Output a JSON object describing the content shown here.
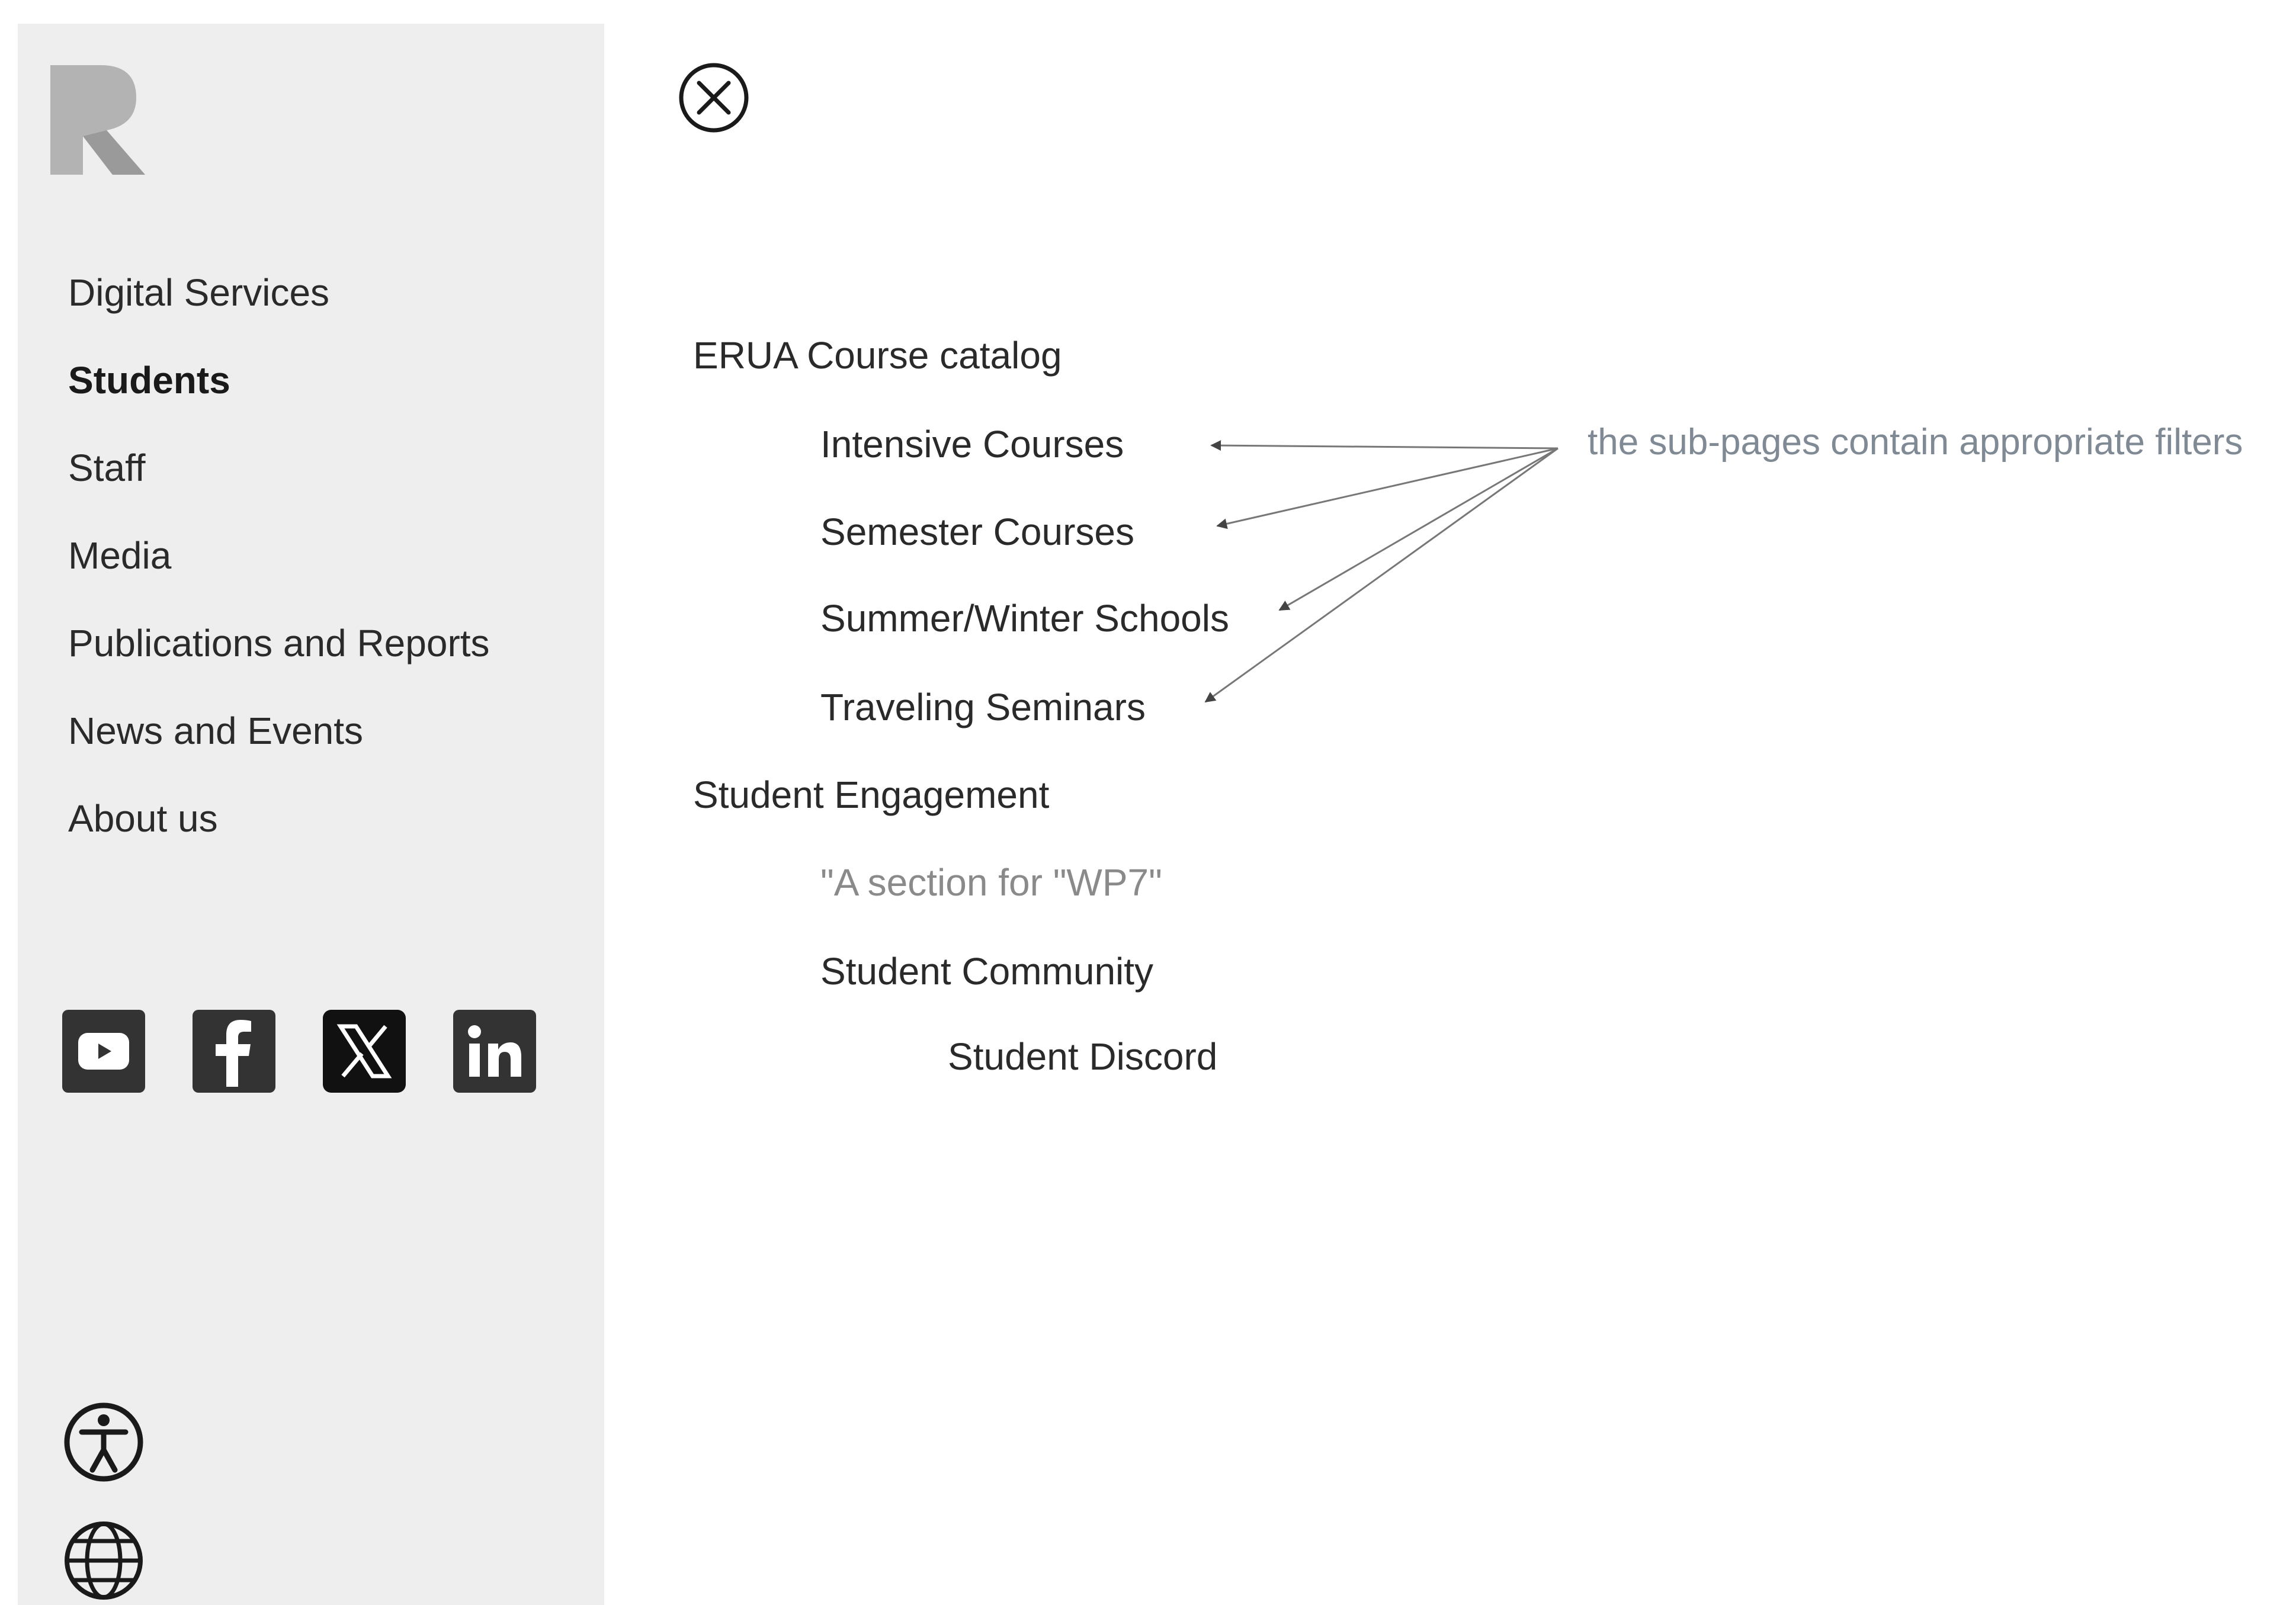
{
  "sidebar": {
    "logo": "erua-logo",
    "nav": [
      {
        "label": "Digital Services",
        "active": false
      },
      {
        "label": "Students",
        "active": true
      },
      {
        "label": "Staff",
        "active": false
      },
      {
        "label": "Media",
        "active": false
      },
      {
        "label": "Publications and Reports",
        "active": false
      },
      {
        "label": "News and Events",
        "active": false
      },
      {
        "label": "About us",
        "active": false
      }
    ],
    "socials": [
      "youtube-icon",
      "facebook-icon",
      "x-icon",
      "linkedin-icon"
    ],
    "utilities": [
      "accessibility-icon",
      "globe-icon"
    ]
  },
  "main": {
    "close_icon": "close-icon",
    "sections": [
      {
        "label": "ERUA Course catalog",
        "items": [
          {
            "label": "Intensive Courses"
          },
          {
            "label": "Semester Courses"
          },
          {
            "label": "Summer/Winter Schools"
          },
          {
            "label": "Traveling Seminars"
          }
        ]
      },
      {
        "label": "Student Engagement",
        "items": [
          {
            "label": "\"A section for \"WP7\"",
            "note": true
          },
          {
            "label": "Student Community",
            "children": [
              {
                "label": "Student Discord"
              }
            ]
          }
        ]
      }
    ],
    "annotation": "the sub-pages contain appropriate filters"
  },
  "colors": {
    "sidebar_bg": "#eeeeee",
    "text": "#2a2a2a",
    "annotation": "#808a94",
    "social_bg": "#333333"
  }
}
